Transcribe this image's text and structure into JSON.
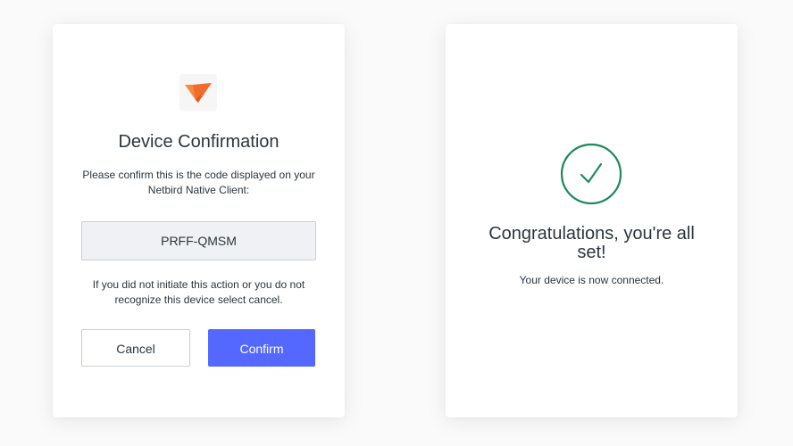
{
  "confirm_card": {
    "logo_icon": "netbird-logo-icon",
    "title": "Device Confirmation",
    "description": "Please confirm this is the code displayed on your Netbird Native Client:",
    "code": "PRFF-QMSM",
    "note": "If you did not initiate this action or you do not recognize this device select cancel.",
    "cancel_label": "Cancel",
    "confirm_label": "Confirm",
    "accent_color": "#5468ff",
    "logo_color": "#f68330"
  },
  "success_card": {
    "check_icon": "check-circle-icon",
    "title": "Congratulations, you're all set!",
    "message": "Your device is now connected.",
    "success_color": "#1e8a5e"
  }
}
